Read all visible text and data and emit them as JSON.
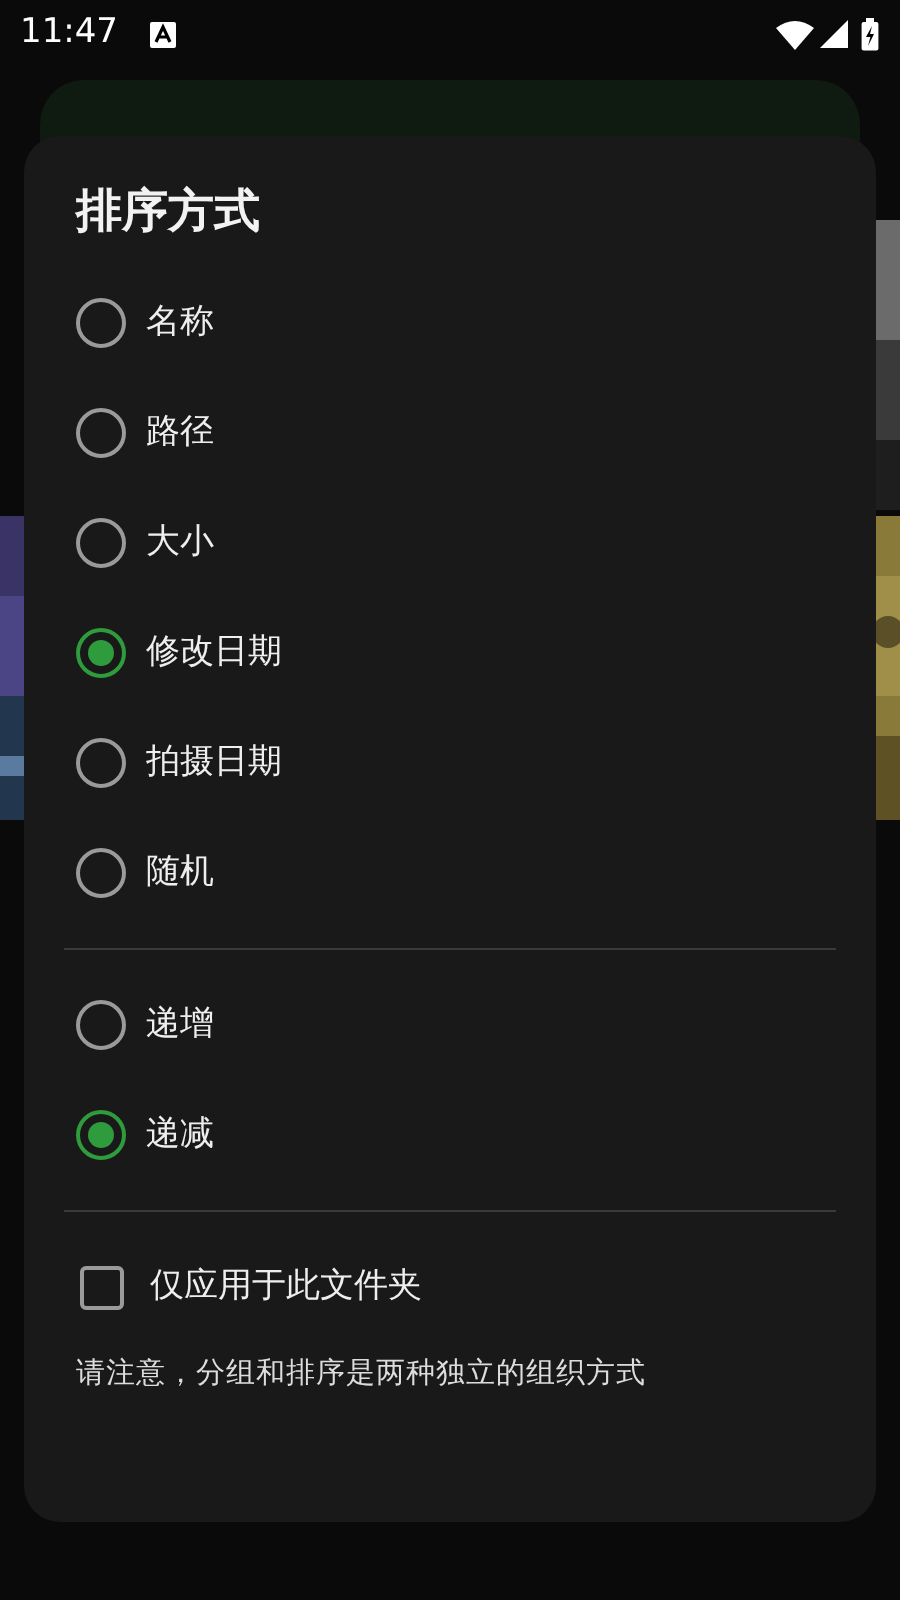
{
  "status_bar": {
    "time": "11:47"
  },
  "dialog": {
    "title": "排序方式",
    "sort_by": [
      {
        "label": "名称",
        "selected": false
      },
      {
        "label": "路径",
        "selected": false
      },
      {
        "label": "大小",
        "selected": false
      },
      {
        "label": "修改日期",
        "selected": true
      },
      {
        "label": "拍摄日期",
        "selected": false
      },
      {
        "label": "随机",
        "selected": false
      }
    ],
    "order": [
      {
        "label": "递增",
        "selected": false
      },
      {
        "label": "递减",
        "selected": true
      }
    ],
    "folder_only": {
      "label": "仅应用于此文件夹",
      "checked": false
    },
    "note": "请注意，分组和排序是两种独立的组织方式"
  }
}
